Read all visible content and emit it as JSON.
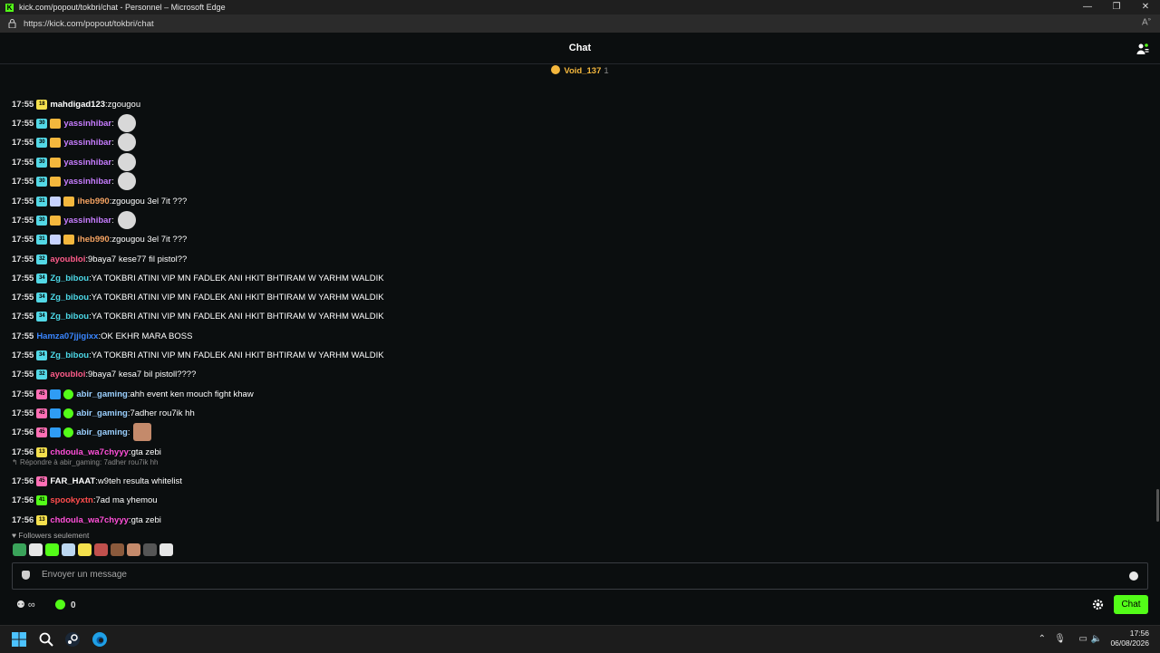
{
  "window": {
    "title": "kick.com/popout/tokbri/chat - Personnel – Microsoft Edge",
    "url": "https://kick.com/popout/tokbri/chat",
    "buttons": [
      "—",
      "❐",
      "✕"
    ]
  },
  "chat": {
    "header": "Chat",
    "pinned_user": "Void_137",
    "pinned_count": "1",
    "reply_context": "Répondre à abir_gaming: 7adher rou7ik hh",
    "followers_label": "Followers seulement",
    "input_placeholder": "Envoyer un message",
    "infinity": "∞",
    "points": "0",
    "send_label": "Chat"
  },
  "messages": [
    {
      "time": "17:55",
      "user": "mahdigad123",
      "color": "#ffffff",
      "badge": "18",
      "badge_color": "#f4e04d",
      "text": "zgougou",
      "emote": false
    },
    {
      "time": "17:55",
      "user": "yassinhibar",
      "color": "#c77dff",
      "badge": "30",
      "badge_color": "#53d8e6",
      "crown": true,
      "text": "",
      "emote": true
    },
    {
      "time": "17:55",
      "user": "yassinhibar",
      "color": "#c77dff",
      "badge": "30",
      "badge_color": "#53d8e6",
      "crown": true,
      "text": "",
      "emote": true
    },
    {
      "time": "17:55",
      "user": "yassinhibar",
      "color": "#c77dff",
      "badge": "30",
      "badge_color": "#53d8e6",
      "crown": true,
      "text": "",
      "emote": true
    },
    {
      "time": "17:55",
      "user": "yassinhibar",
      "color": "#c77dff",
      "badge": "30",
      "badge_color": "#53d8e6",
      "crown": true,
      "text": "",
      "emote": true
    },
    {
      "time": "17:55",
      "user": "iheb990",
      "color": "#f4a261",
      "badge": "31",
      "badge_color": "#53d8e6",
      "gift": true,
      "crown": true,
      "text": "zgougou 3el 7it ???",
      "emote": false
    },
    {
      "time": "17:55",
      "user": "yassinhibar",
      "color": "#c77dff",
      "badge": "30",
      "badge_color": "#53d8e6",
      "crown": true,
      "text": "",
      "emote": true
    },
    {
      "time": "17:55",
      "user": "iheb990",
      "color": "#f4a261",
      "badge": "31",
      "badge_color": "#53d8e6",
      "gift": true,
      "crown": true,
      "text": "zgougou 3el 7it ???",
      "emote": false
    },
    {
      "time": "17:55",
      "user": "ayoubloi",
      "color": "#ff5c8a",
      "badge": "32",
      "badge_color": "#53d8e6",
      "text": "9baya7 kese77 fil pistol??",
      "emote": false
    },
    {
      "time": "17:55",
      "user": "Zg_bibou",
      "color": "#4dd9e8",
      "badge": "34",
      "badge_color": "#53d8e6",
      "text": "YA TOKBRI ATINI VIP MN FADLEK ANI HKIT BHTIRAM W YARHM WALDIK",
      "emote": false
    },
    {
      "time": "17:55",
      "user": "Zg_bibou",
      "color": "#4dd9e8",
      "badge": "34",
      "badge_color": "#53d8e6",
      "text": "YA TOKBRI ATINI VIP MN FADLEK ANI HKIT BHTIRAM W YARHM WALDIK",
      "emote": false
    },
    {
      "time": "17:55",
      "user": "Zg_bibou",
      "color": "#4dd9e8",
      "badge": "34",
      "badge_color": "#53d8e6",
      "text": "YA TOKBRI ATINI VIP MN FADLEK ANI HKIT BHTIRAM W YARHM WALDIK",
      "emote": false
    },
    {
      "time": "17:55",
      "user": "Hamza07jjigixx",
      "color": "#3a86ff",
      "text": "OK EKHR MARA BOSS",
      "emote": false
    },
    {
      "time": "17:55",
      "user": "Zg_bibou",
      "color": "#4dd9e8",
      "badge": "34",
      "badge_color": "#53d8e6",
      "text": "YA TOKBRI ATINI VIP MN FADLEK ANI HKIT BHTIRAM W YARHM WALDIK",
      "emote": false
    },
    {
      "time": "17:55",
      "user": "ayoubloi",
      "color": "#ff5c8a",
      "badge": "32",
      "badge_color": "#53d8e6",
      "text": "9baya7 kesa7 bil pistoll????",
      "emote": false
    },
    {
      "time": "17:55",
      "user": "abir_gaming",
      "color": "#9bd0ff",
      "badge": "45",
      "badge_color": "#ff6fb5",
      "mod": true,
      "verified": true,
      "text": "ahh event ken mouch fight khaw",
      "emote": false
    },
    {
      "time": "17:55",
      "user": "abir_gaming",
      "color": "#9bd0ff",
      "badge": "45",
      "badge_color": "#ff6fb5",
      "mod": true,
      "verified": true,
      "text": "7adher rou7ik hh",
      "emote": false
    },
    {
      "time": "17:56",
      "user": "abir_gaming",
      "color": "#9bd0ff",
      "badge": "45",
      "badge_color": "#ff6fb5",
      "mod": true,
      "verified": true,
      "text": "",
      "emote2": true
    },
    {
      "time": "17:56",
      "user": "chdoula_wa7chyyy",
      "color": "#ff4fd8",
      "badge": "13",
      "badge_color": "#f4e04d",
      "text": "gta zebi",
      "emote": false
    },
    {
      "time": "17:56",
      "user": "FAR_HAAT",
      "color": "#ffffff",
      "badge": "45",
      "badge_color": "#ff6fb5",
      "text": "w9teh resulta whitelist",
      "emote": false
    },
    {
      "time": "17:56",
      "user": "spookyxtn",
      "color": "#ff4d4d",
      "badge": "41",
      "badge_color": "#53fc18",
      "text": "7ad ma yhemou",
      "emote": false
    },
    {
      "time": "17:56",
      "user": "chdoula_wa7chyyy",
      "color": "#ff4fd8",
      "badge": "13",
      "badge_color": "#f4e04d",
      "text": "gta zebi",
      "emote": false
    }
  ],
  "taskbar": {
    "time": "17:56",
    "date": "06/08/2026"
  }
}
